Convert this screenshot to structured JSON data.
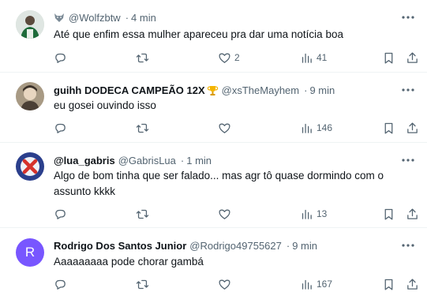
{
  "tweets": [
    {
      "name": "",
      "handle": "@Wolfzbtw",
      "time": "4 min",
      "text": "Até que enfim essa mulher apareceu pra dar uma notícia boa",
      "likes": "2",
      "views": "41"
    },
    {
      "name": "guihh DODECA CAMPEÃO 12X",
      "handle": "@xsTheMayhem",
      "time": "9 min",
      "text": "eu gosei ouvindo isso",
      "likes": "",
      "views": "146"
    },
    {
      "name": "@lua_gabris",
      "handle": "@GabrisLua",
      "time": "1 min",
      "text": "Algo de bom tinha que ser falado... mas agr tô quase dormindo com o assunto kkkk",
      "likes": "",
      "views": "13"
    },
    {
      "name": "Rodrigo Dos Santos Junior",
      "handle": "@Rodrigo49755627",
      "time": "9 min",
      "text": "Aaaaaaaaa pode chorar gambá",
      "likes": "",
      "views": "167",
      "avatar_letter": "R"
    }
  ],
  "separator": "·",
  "colors": {
    "text": "#0f1419",
    "muted": "#536471",
    "divider": "#eff3f4",
    "avatar_r": "#7856ff"
  }
}
